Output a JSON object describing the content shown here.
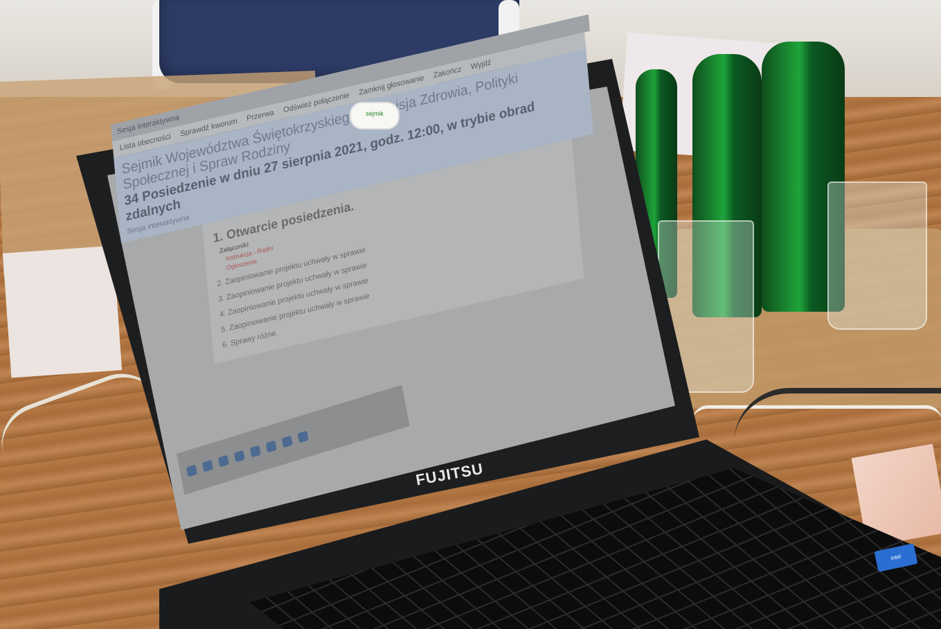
{
  "scene": {
    "description_tag": "laptop on wooden table with green bottles",
    "brand_logo": "FUJITSU",
    "webcam_cover_label": "sejmik"
  },
  "browser": {
    "tab_title": "Sesja interaktywna"
  },
  "app": {
    "nav": [
      "Lista obecności",
      "Sprawdź kworum",
      "Przerwa",
      "Odśwież połączenie",
      "Zamknij głosowanie",
      "Zakończ",
      "Wyjdź"
    ],
    "title": "Sejmik Województwa Świętokrzyskiego / Komisja Zdrowia, Polityki Społecznej i Spraw Rodziny",
    "subtitle": "34 Posiedzenie w dniu 27 sierpnia 2021, godz. 12:00, w trybie obrad zdalnych",
    "mode": "Sesja interaktywna"
  },
  "agenda": {
    "item1": "1. Otwarcie posiedzenia.",
    "attachments_label": "Załączniki",
    "attachments": [
      "Instrukcja - Radni",
      "Ogłoszenie"
    ],
    "items": [
      "2. Zaopiniowanie projektu uchwały w sprawie",
      "3. Zaopiniowanie projektu uchwały w sprawie",
      "4. Zaopiniowanie projektu uchwały w sprawie",
      "5. Zaopiniowanie projektu uchwały w sprawie",
      "6. Sprawy różne."
    ]
  }
}
